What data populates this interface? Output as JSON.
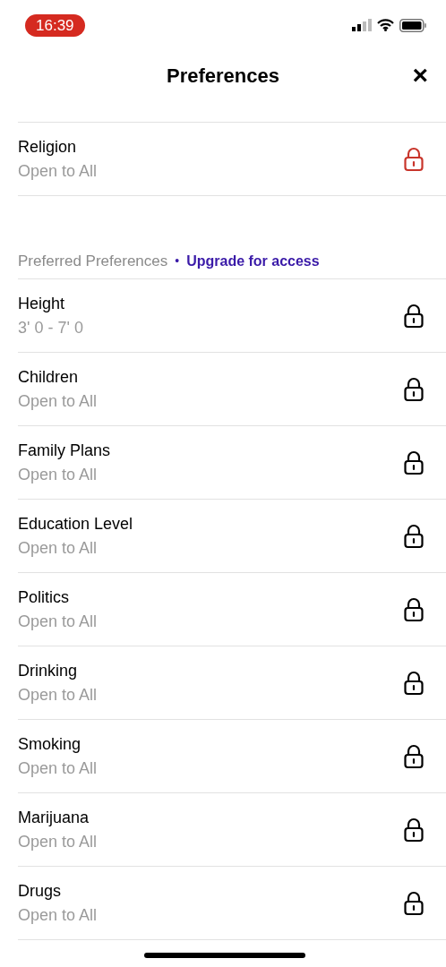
{
  "status_bar": {
    "time": "16:39"
  },
  "header": {
    "title": "Preferences",
    "close": "×"
  },
  "top_rows": [
    {
      "title": "Religion",
      "value": "Open to All",
      "color": "#c8352b"
    }
  ],
  "section": {
    "title": "Preferred Preferences",
    "separator": "•",
    "link": "Upgrade for access"
  },
  "rows": [
    {
      "title": "Height",
      "value": "3' 0 - 7' 0",
      "color": "#000000"
    },
    {
      "title": "Children",
      "value": "Open to All",
      "color": "#000000"
    },
    {
      "title": "Family Plans",
      "value": "Open to All",
      "color": "#000000"
    },
    {
      "title": "Education Level",
      "value": "Open to All",
      "color": "#000000"
    },
    {
      "title": "Politics",
      "value": "Open to All",
      "color": "#000000"
    },
    {
      "title": "Drinking",
      "value": "Open to All",
      "color": "#000000"
    },
    {
      "title": "Smoking",
      "value": "Open to All",
      "color": "#000000"
    },
    {
      "title": "Marijuana",
      "value": "Open to All",
      "color": "#000000"
    },
    {
      "title": "Drugs",
      "value": "Open to All",
      "color": "#000000"
    }
  ]
}
